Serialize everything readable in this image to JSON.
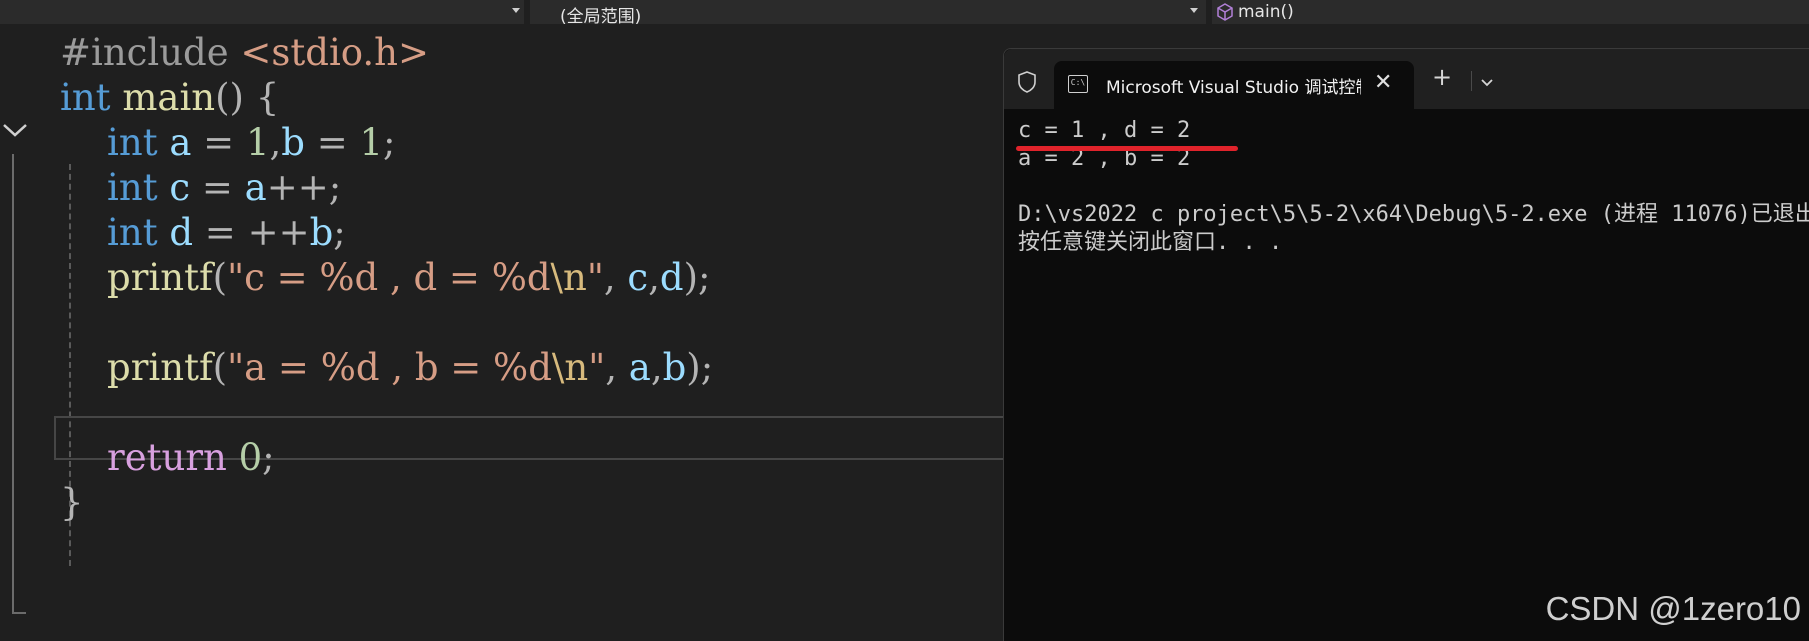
{
  "navbar": {
    "scope_label": "(全局范围)",
    "function_label": "main()"
  },
  "editor": {
    "lines": [
      {
        "tokens": [
          {
            "t": "#include",
            "c": "pre"
          },
          {
            "t": " ",
            "c": "pl"
          },
          {
            "t": "<stdio.h>",
            "c": "str"
          }
        ]
      },
      {
        "tokens": [
          {
            "t": "int",
            "c": "kw"
          },
          {
            "t": " ",
            "c": "pl"
          },
          {
            "t": "main",
            "c": "fn"
          },
          {
            "t": "() {",
            "c": "op"
          }
        ]
      },
      {
        "tokens": [
          {
            "t": "    ",
            "c": "pl"
          },
          {
            "t": "int",
            "c": "kw"
          },
          {
            "t": " ",
            "c": "pl"
          },
          {
            "t": "a",
            "c": "var"
          },
          {
            "t": " = ",
            "c": "op"
          },
          {
            "t": "1",
            "c": "num"
          },
          {
            "t": ",",
            "c": "op"
          },
          {
            "t": "b",
            "c": "var"
          },
          {
            "t": " = ",
            "c": "op"
          },
          {
            "t": "1",
            "c": "num"
          },
          {
            "t": ";",
            "c": "op"
          }
        ]
      },
      {
        "tokens": [
          {
            "t": "    ",
            "c": "pl"
          },
          {
            "t": "int",
            "c": "kw"
          },
          {
            "t": " ",
            "c": "pl"
          },
          {
            "t": "c",
            "c": "var"
          },
          {
            "t": " = ",
            "c": "op"
          },
          {
            "t": "a",
            "c": "var"
          },
          {
            "t": "++;",
            "c": "op"
          }
        ]
      },
      {
        "tokens": [
          {
            "t": "    ",
            "c": "pl"
          },
          {
            "t": "int",
            "c": "kw"
          },
          {
            "t": " ",
            "c": "pl"
          },
          {
            "t": "d",
            "c": "var"
          },
          {
            "t": " = ++",
            "c": "op"
          },
          {
            "t": "b",
            "c": "var"
          },
          {
            "t": ";",
            "c": "op"
          }
        ]
      },
      {
        "tokens": [
          {
            "t": "    ",
            "c": "pl"
          },
          {
            "t": "printf",
            "c": "fn"
          },
          {
            "t": "(",
            "c": "op"
          },
          {
            "t": "\"c = ",
            "c": "str"
          },
          {
            "t": "%d",
            "c": "fmt"
          },
          {
            "t": " , d = ",
            "c": "str"
          },
          {
            "t": "%d",
            "c": "fmt"
          },
          {
            "t": "\\n",
            "c": "esc"
          },
          {
            "t": "\"",
            "c": "str"
          },
          {
            "t": ", ",
            "c": "op"
          },
          {
            "t": "c",
            "c": "var"
          },
          {
            "t": ",",
            "c": "op"
          },
          {
            "t": "d",
            "c": "var"
          },
          {
            "t": ");",
            "c": "op"
          }
        ]
      },
      {
        "tokens": []
      },
      {
        "tokens": [
          {
            "t": "    ",
            "c": "pl"
          },
          {
            "t": "printf",
            "c": "fn"
          },
          {
            "t": "(",
            "c": "op"
          },
          {
            "t": "\"a = ",
            "c": "str"
          },
          {
            "t": "%d",
            "c": "fmt"
          },
          {
            "t": " , b = ",
            "c": "str"
          },
          {
            "t": "%d",
            "c": "fmt"
          },
          {
            "t": "\\n",
            "c": "esc"
          },
          {
            "t": "\"",
            "c": "str"
          },
          {
            "t": ", ",
            "c": "op"
          },
          {
            "t": "a",
            "c": "var"
          },
          {
            "t": ",",
            "c": "op"
          },
          {
            "t": "b",
            "c": "var"
          },
          {
            "t": ");",
            "c": "op"
          }
        ]
      },
      {
        "tokens": []
      },
      {
        "tokens": [
          {
            "t": "    ",
            "c": "pl"
          },
          {
            "t": "return",
            "c": "kw2"
          },
          {
            "t": " ",
            "c": "pl"
          },
          {
            "t": "0",
            "c": "num"
          },
          {
            "t": ";",
            "c": "op"
          }
        ]
      },
      {
        "tokens": [
          {
            "t": "}",
            "c": "op"
          }
        ]
      }
    ]
  },
  "console": {
    "tab_title": "Microsoft Visual Studio 调试控制台",
    "output": [
      "c = 1 , d = 2",
      "a = 2 , b = 2",
      "",
      "D:\\vs2022 c project\\5\\5-2\\x64\\Debug\\5-2.exe (进程 11076)已退出",
      "按任意键关闭此窗口. . ."
    ],
    "underline_color": "#e0232b"
  },
  "watermark": "CSDN @1zero10"
}
